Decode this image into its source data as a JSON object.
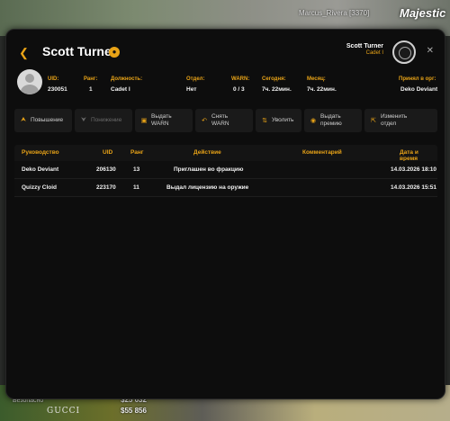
{
  "hud": {
    "player_name": "Marcus_Rivera [3370]",
    "logo": "Majestic",
    "cash": "$25 032",
    "bank": "$55 856",
    "status": "Безопасно",
    "brand": "GUCCI"
  },
  "header": {
    "back_icon": "chevron-left-icon",
    "title": "Scott Turner",
    "badge_icon": "user-badge-icon",
    "corner_name": "Scott Turner",
    "corner_rank": "Cadet I",
    "close_icon": "close-icon"
  },
  "info": [
    {
      "label": "UID:",
      "value": "230051"
    },
    {
      "label": "Ранг:",
      "value": "1"
    },
    {
      "label": "Должность:",
      "value": "Cadet I"
    },
    {
      "label": "Отдел:",
      "value": "Нет"
    },
    {
      "label": "WARN:",
      "value": "0 / 3"
    },
    {
      "label": "Сегодня:",
      "value": "7ч. 22мин."
    },
    {
      "label": "Месяц:",
      "value": "7ч. 22мин."
    },
    {
      "label": "Принял в орг:",
      "value": "Deko Deviant"
    }
  ],
  "actions": [
    {
      "icon": "chevrons-up-icon",
      "label": "Повышение",
      "enabled": true
    },
    {
      "icon": "chevrons-down-icon",
      "label": "Понижение",
      "enabled": false
    },
    {
      "icon": "warn-add-icon",
      "label": "Выдать\nWARN",
      "enabled": true
    },
    {
      "icon": "warn-remove-icon",
      "label": "Снять\nWARN",
      "enabled": true
    },
    {
      "icon": "fire-icon",
      "label": "Уволить",
      "enabled": true
    },
    {
      "icon": "bonus-icon",
      "label": "Выдать\nпремию",
      "enabled": true
    },
    {
      "icon": "change-dept-icon",
      "label": "Изменить\nотдел",
      "enabled": true
    }
  ],
  "table": {
    "columns": [
      "Руководство",
      "UID",
      "Ранг",
      "Действие",
      "Комментарий",
      "Дата и время"
    ],
    "rows": [
      {
        "leader": "Deko Deviant",
        "uid": "206130",
        "rank": "13",
        "action": "Приглашен во фракцию",
        "comment": "",
        "datetime": "14.03.2026 18:10"
      },
      {
        "leader": "Quizzy Cloid",
        "uid": "223170",
        "rank": "11",
        "action": "Выдал лицензию на оружие",
        "comment": "",
        "datetime": "14.03.2026 15:51"
      }
    ]
  },
  "colors": {
    "accent": "#e8a317",
    "panel": "#0d0d0d"
  }
}
